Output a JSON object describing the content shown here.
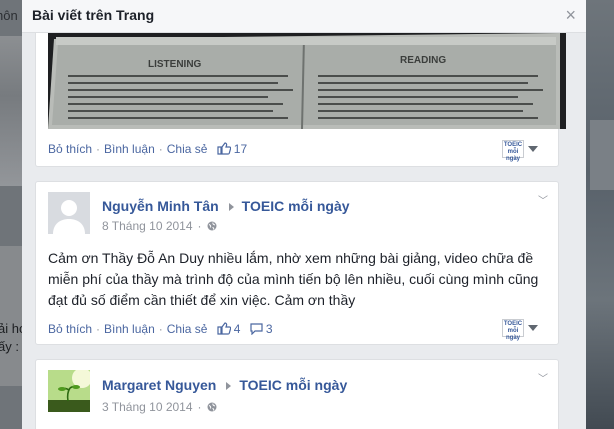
{
  "background": {
    "left_top_text": "hôn",
    "left_text_lines": [
      "ải họ",
      "ấy :"
    ]
  },
  "dialog": {
    "title": "Bài viết trên Trang",
    "close_glyph": "×"
  },
  "posts": [
    {
      "photo_labels": [
        "LISTENING",
        "READING"
      ],
      "actions": {
        "like": "Bỏ thích",
        "comment": "Bình luận",
        "share": "Chia sẻ"
      },
      "like_count": "17",
      "page_badge": [
        "TOEIC",
        "mỗi ngày"
      ]
    },
    {
      "author": "Nguyễn Minh Tân",
      "page": "TOEIC mỗi ngày",
      "date": "8 Tháng 10 2014",
      "text": "Cảm ơn Thầy Đỗ An Duy nhiều lắm, nhờ xem những bài giảng, video chữa đề miễn phí của thầy mà trình độ của mình tiến bộ lên nhiều, cuối cùng mình cũng đạt đủ số điểm cần thiết để xin việc. Cảm ơn thầy",
      "actions": {
        "like": "Bỏ thích",
        "comment": "Bình luận",
        "share": "Chia sẻ"
      },
      "like_count": "4",
      "comment_count": "3",
      "page_badge": [
        "TOEIC",
        "mỗi ngày"
      ]
    },
    {
      "author": "Margaret Nguyen",
      "page": "TOEIC mỗi ngày",
      "date": "3 Tháng 10 2014"
    }
  ],
  "colors": {
    "link": "#365899",
    "action": "#4b67a1",
    "muted": "#90949c",
    "text": "#1d2129",
    "dialog_bg": "#e9ebee"
  }
}
